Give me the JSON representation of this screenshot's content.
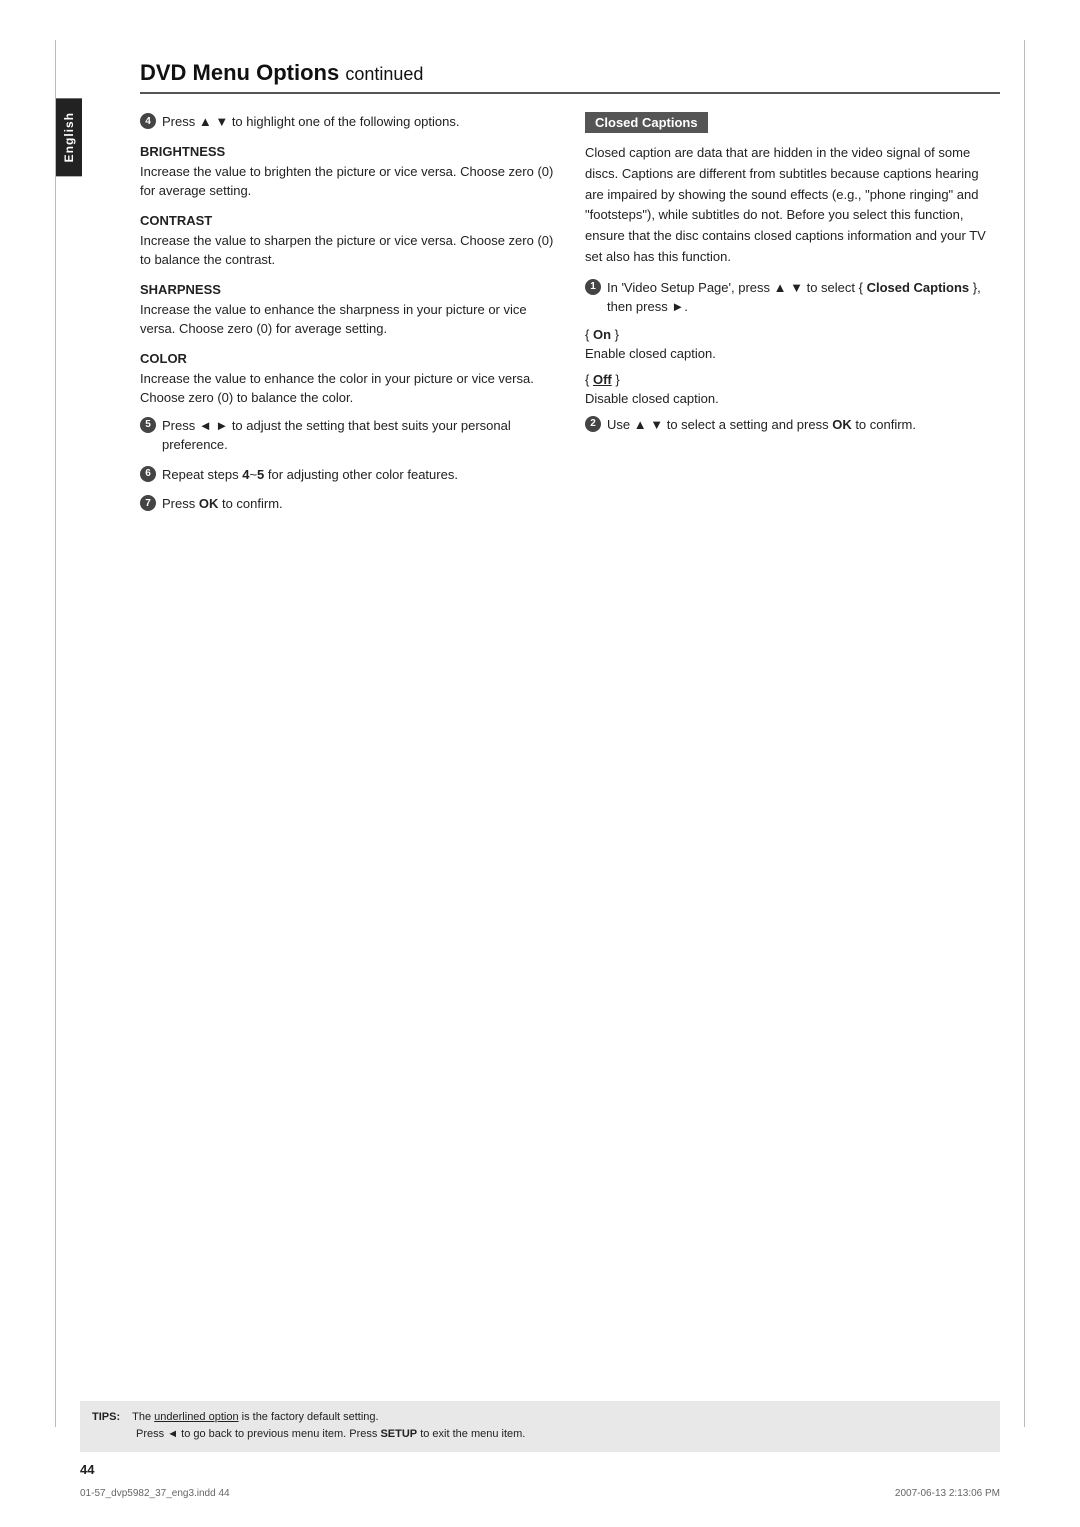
{
  "page": {
    "title": "DVD Menu Options",
    "title_continued": "continued",
    "page_number": "44",
    "footer_left": "01-57_dvp5982_37_eng3.indd  44",
    "footer_right": "2007-06-13  2:13:06 PM"
  },
  "english_tab": "English",
  "left_column": {
    "step4": {
      "number": "4",
      "text": "Press ▲ ▼ to highlight one of the following options."
    },
    "brightness": {
      "heading": "BRIGHTNESS",
      "body": "Increase the value to brighten the picture or vice versa. Choose zero (0) for average setting."
    },
    "contrast": {
      "heading": "CONTRAST",
      "body": "Increase the value to sharpen the picture or vice versa.  Choose zero (0) to balance the contrast."
    },
    "sharpness": {
      "heading": "SHARPNESS",
      "body": "Increase the value to enhance the sharpness in your picture or vice versa. Choose zero (0) for average setting."
    },
    "color": {
      "heading": "COLOR",
      "body": "Increase the value to enhance the color in your picture or vice versa. Choose zero (0) to balance the color."
    },
    "step5": {
      "number": "5",
      "text": "Press ◄ ► to adjust the setting that best suits your personal preference."
    },
    "step6": {
      "number": "6",
      "text": "Repeat steps 4~5 for adjusting other color features."
    },
    "step7": {
      "number": "7",
      "text": "Press OK to confirm."
    }
  },
  "right_column": {
    "closed_captions_heading": "Closed Captions",
    "intro": "Closed caption are data that are hidden in the video signal of some discs. Captions are different from subtitles because captions hearing are impaired by showing the sound effects (e.g., \"phone ringing\" and \"footsteps\"), while subtitles do not. Before you select this function, ensure that the disc contains closed captions information and your TV set also has this function.",
    "step1": {
      "number": "1",
      "text": "In 'Video Setup Page', press ▲ ▼ to select { Closed Captions }, then press ►."
    },
    "on_label": "{ On }",
    "on_desc": "Enable closed caption.",
    "off_label": "{ Off }",
    "off_desc": "Disable closed caption.",
    "step2": {
      "number": "2",
      "text": "Use ▲ ▼ to select a setting and press OK to confirm."
    }
  },
  "tips": {
    "label": "TIPS:",
    "line1": "The underlined option is the factory default setting.",
    "line2": "Press ◄ to go back to previous menu item. Press SETUP to exit the menu item."
  }
}
